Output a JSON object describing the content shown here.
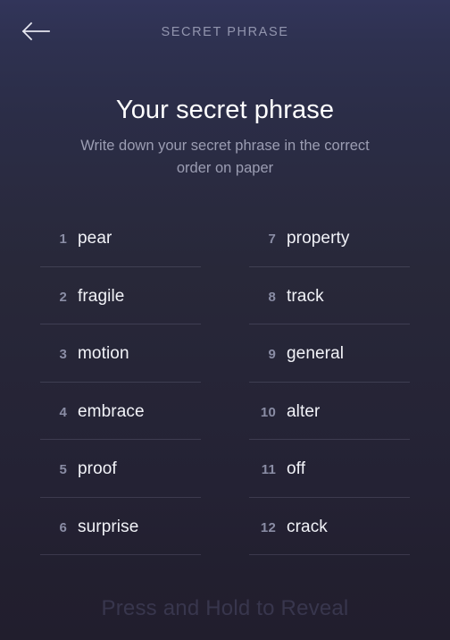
{
  "appbar": {
    "title": "SECRET PHRASE",
    "back_icon": "arrow-left-icon"
  },
  "header": {
    "title": "Your secret phrase",
    "subtitle": "Write down your secret phrase in the correct order on paper"
  },
  "phrase": {
    "left_column": [
      {
        "index": "1",
        "word": "pear"
      },
      {
        "index": "2",
        "word": "fragile"
      },
      {
        "index": "3",
        "word": "motion"
      },
      {
        "index": "4",
        "word": "embrace"
      },
      {
        "index": "5",
        "word": "proof"
      },
      {
        "index": "6",
        "word": "surprise"
      }
    ],
    "right_column": [
      {
        "index": "7",
        "word": "property"
      },
      {
        "index": "8",
        "word": "track"
      },
      {
        "index": "9",
        "word": "general"
      },
      {
        "index": "10",
        "word": "alter"
      },
      {
        "index": "11",
        "word": "off"
      },
      {
        "index": "12",
        "word": "crack"
      }
    ]
  },
  "footer": {
    "reveal_hint": "Press and Hold to Reveal"
  },
  "colors": {
    "background_top": "#32355a",
    "background_bottom": "#211e2d",
    "title_text": "#ffffff",
    "subtitle_text": "#9b9db2",
    "appbar_title_text": "#9295ae",
    "index_text": "#8a8da5",
    "word_text": "#f2f3f8",
    "divider": "rgba(190,195,225,0.16)",
    "reveal_hint_text": "rgba(150,150,205,0.20)"
  }
}
